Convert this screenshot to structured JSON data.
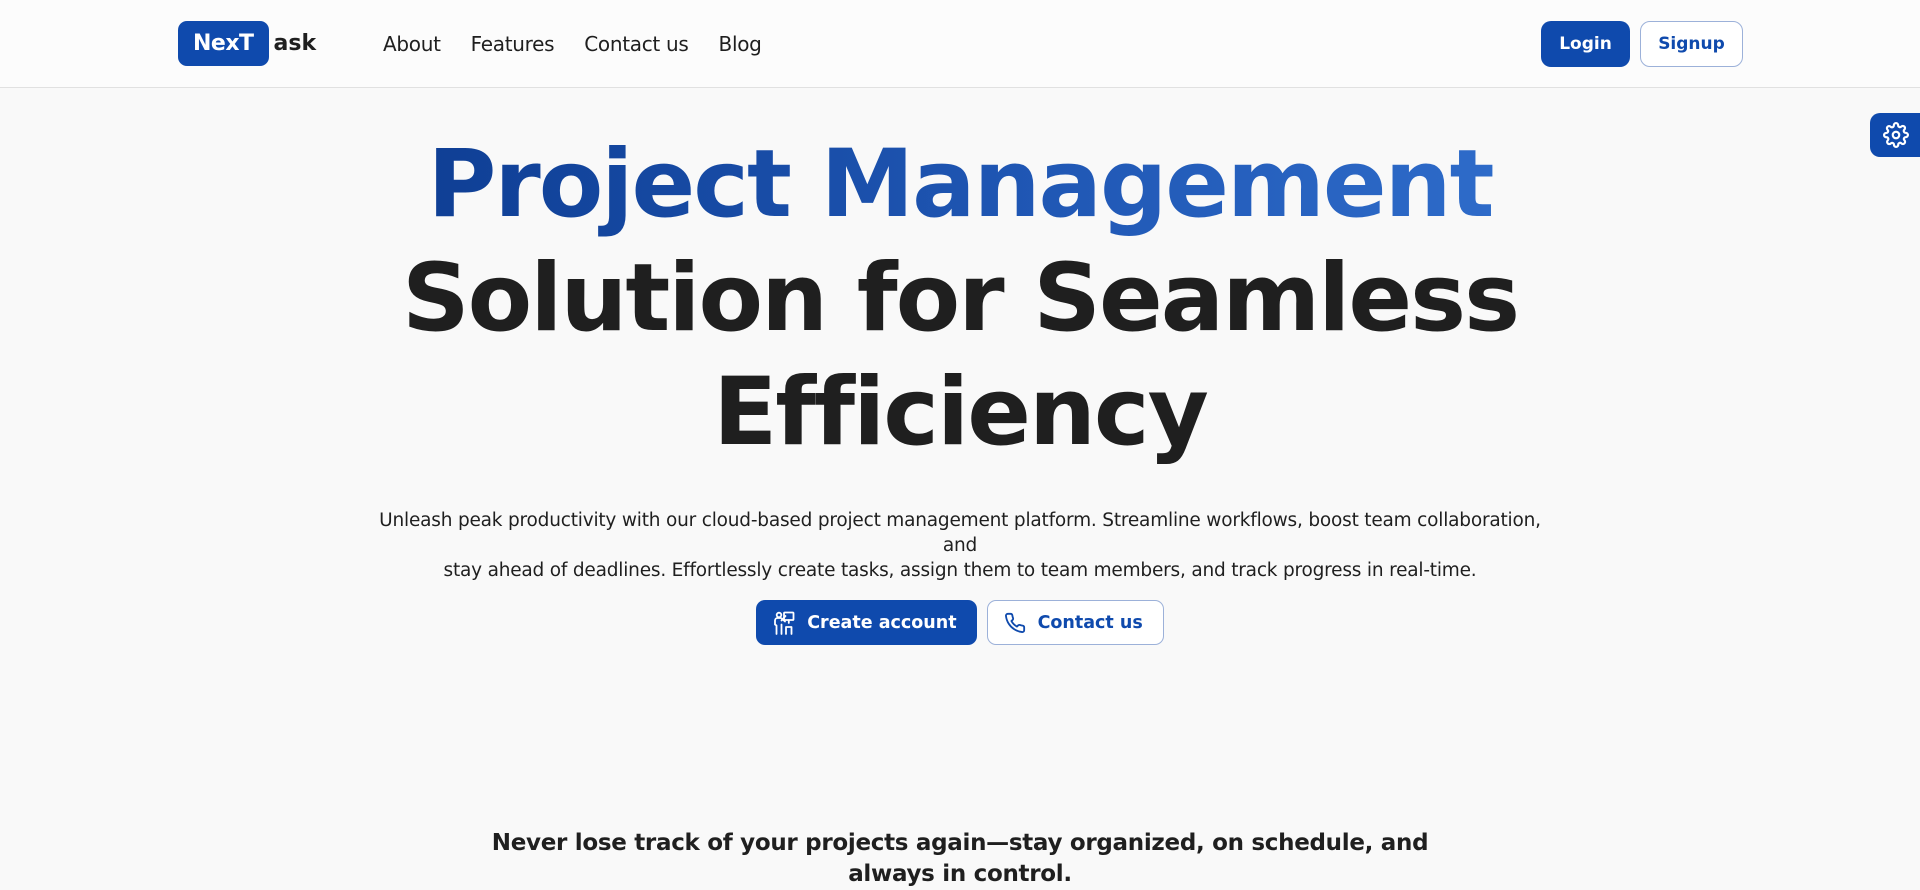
{
  "brand": {
    "logo_box": "NexT",
    "logo_rest": "ask",
    "primary_color": "#0f4aad"
  },
  "nav": {
    "links": [
      "About",
      "Features",
      "Contact us",
      "Blog"
    ]
  },
  "auth": {
    "login_label": "Login",
    "signup_label": "Signup"
  },
  "settings": {
    "icon": "gear-icon"
  },
  "hero": {
    "title_line1": "Project Management",
    "title_line2": "Solution for Seamless",
    "title_line3": "Efficiency",
    "subtitle_line1": "Unleash peak productivity with our cloud-based project management platform. Streamline workflows, boost team collaboration, and",
    "subtitle_line2": "stay ahead of deadlines. Effortlessly create tasks, assign them to team members, and track progress in real-time.",
    "cta_primary_label": "Create account",
    "cta_primary_icon": "presenter-icon",
    "cta_secondary_label": "Contact us",
    "cta_secondary_icon": "phone-icon"
  },
  "section": {
    "tagline_line1": "Never lose track of your projects again—stay organized, on schedule, and",
    "tagline_line2": "always in control."
  }
}
